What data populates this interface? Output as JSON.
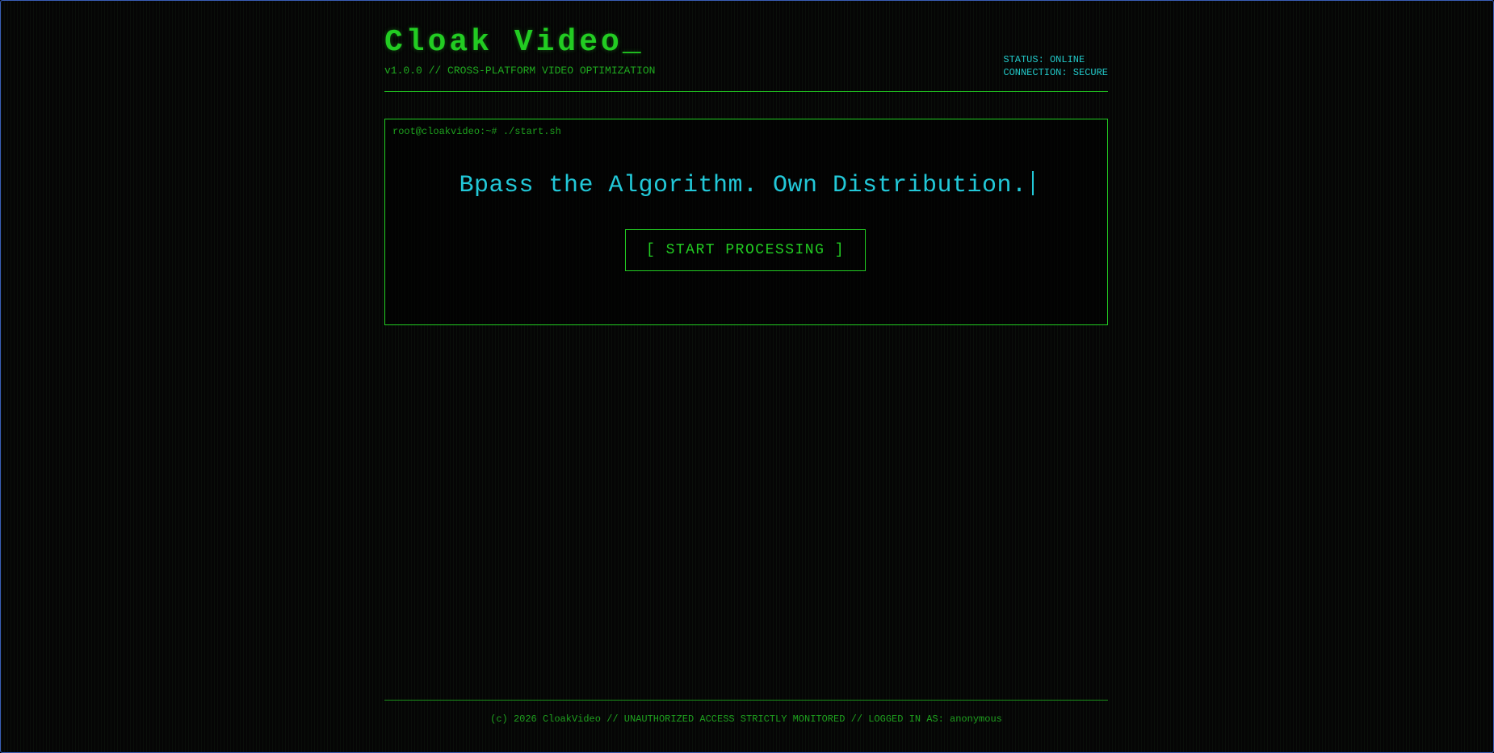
{
  "header": {
    "title": "Cloak Video_",
    "subtitle": "v1.0.0 // CROSS-PLATFORM VIDEO OPTIMIZATION",
    "status": "STATUS: ONLINE",
    "connection": "CONNECTION: SECURE"
  },
  "terminal": {
    "prompt": "root@cloakvideo:~# ./start.sh",
    "headline": "Bpass the Algorithm. Own Distribution.",
    "start_button_label": "[ START PROCESSING ]"
  },
  "footer": {
    "text": "(c) 2026 CloakVideo // UNAUTHORIZED ACCESS STRICTLY MONITORED // LOGGED IN AS: anonymous"
  },
  "colors": {
    "primary_green": "#22cc22",
    "accent_cyan": "#22c8d8",
    "background": "#050505",
    "frame_border": "#3a5fb8"
  }
}
